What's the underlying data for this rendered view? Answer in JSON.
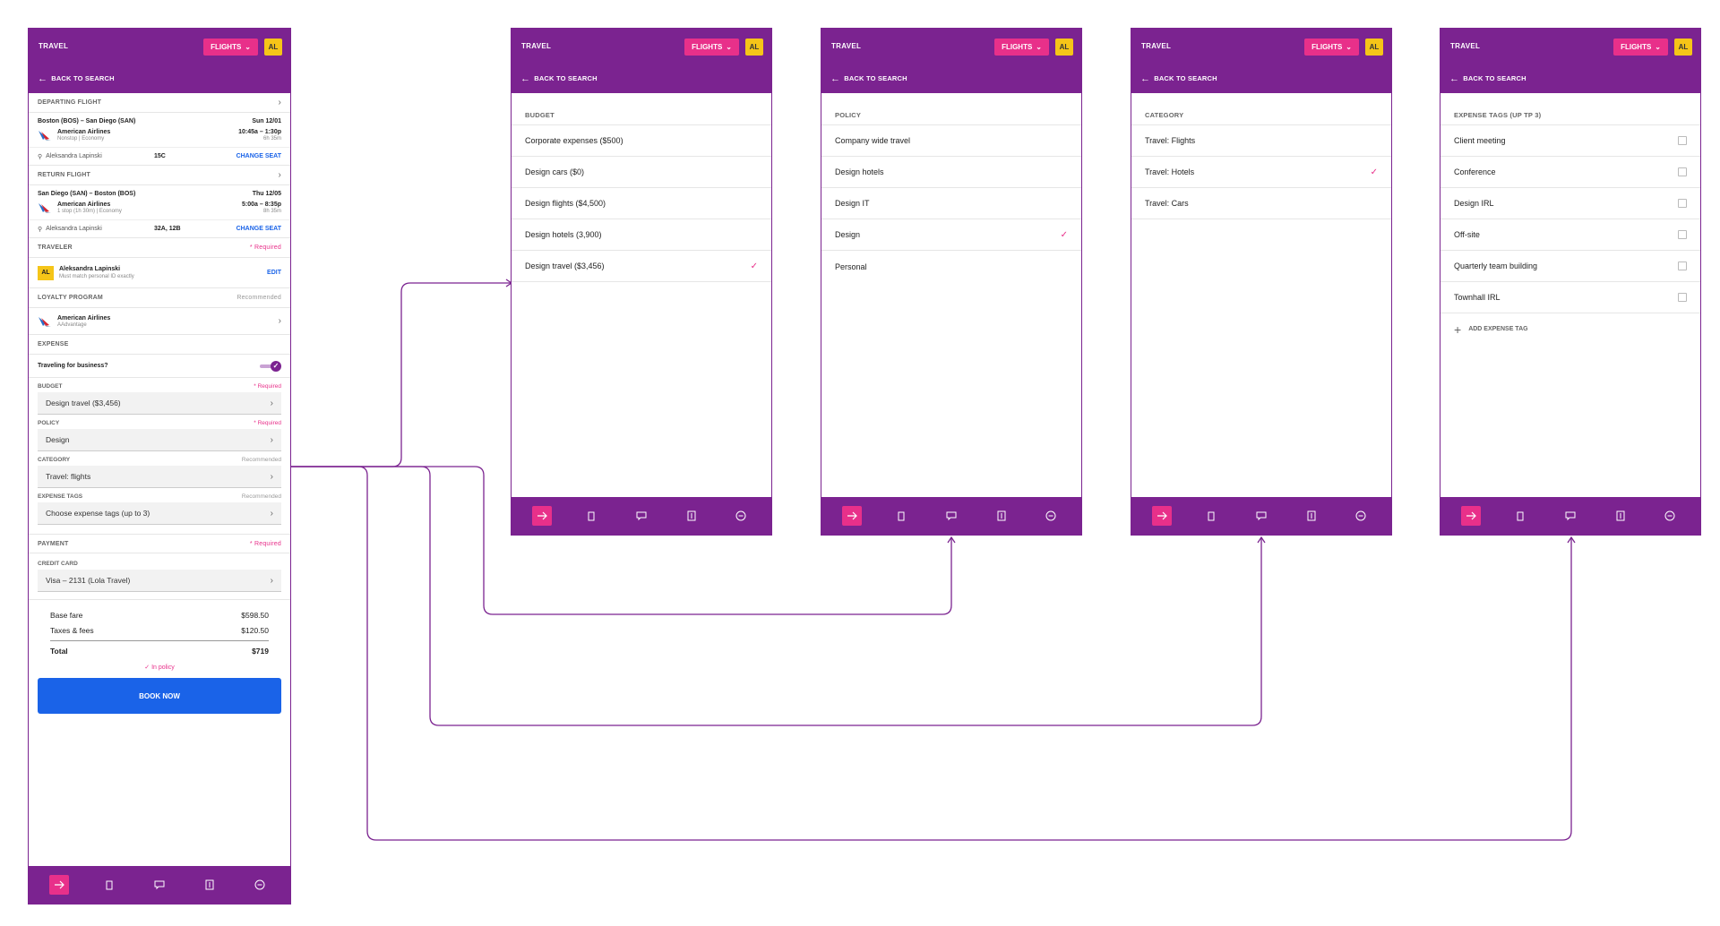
{
  "app": {
    "title": "TRAVEL",
    "flights_label": "FLIGHTS",
    "avatar_initials": "AL",
    "back_label": "BACK TO SEARCH"
  },
  "nav_icons": [
    "flight-icon",
    "luggage-icon",
    "chat-icon",
    "receipt-icon",
    "more-icon"
  ],
  "colors": {
    "header": "#7b2390",
    "accent": "#e8308a",
    "primary_button": "#1a63e8",
    "avatar": "#f5c518"
  },
  "booking": {
    "departing": {
      "header": "DEPARTING FLIGHT",
      "route": "Boston (BOS) – San Diego (SAN)",
      "date": "Sun 12/01",
      "airline": "American Airlines",
      "detail": "Nonstop | Economy",
      "times": "10:45a – 1:30p",
      "duration": "6h 35m",
      "traveler": "Aleksandra Lapinski",
      "seat": "15C",
      "change_seat": "CHANGE SEAT"
    },
    "return": {
      "header": "RETURN FLIGHT",
      "route": "San Diego (SAN) – Boston (BOS)",
      "date": "Thu 12/05",
      "airline": "American Airlines",
      "detail": "1 stop (1h 30m) | Economy",
      "times": "5:00a – 8:35p",
      "duration": "8h 35m",
      "traveler": "Aleksandra Lapinski",
      "seat": "32A, 12B",
      "change_seat": "CHANGE SEAT"
    },
    "traveler_section": {
      "header": "TRAVELER",
      "required": "* Required",
      "name": "Aleksandra Lapinski",
      "note": "Must match personal ID exactly",
      "edit": "EDIT"
    },
    "loyalty": {
      "header": "LOYALTY PROGRAM",
      "recommended": "Recommended",
      "airline": "American Airlines",
      "program": "AAdvantage"
    },
    "expense": {
      "header": "EXPENSE",
      "business_question": "Traveling for business?",
      "business_on": true,
      "budget_label": "BUDGET",
      "budget_req": "* Required",
      "budget_value": "Design travel  ($3,456)",
      "policy_label": "POLICY",
      "policy_req": "* Required",
      "policy_value": "Design",
      "category_label": "CATEGORY",
      "category_rec": "Recommended",
      "category_value": "Travel: flights",
      "tags_label": "EXPENSE TAGS",
      "tags_rec": "Recommended",
      "tags_value": "Choose expense tags (up to 3)"
    },
    "payment": {
      "header": "PAYMENT",
      "required": "* Required",
      "card_label": "CREDIT CARD",
      "card_value": "Visa – 2131 (Lola Travel)"
    },
    "fare": {
      "base_label": "Base fare",
      "base_value": "$598.50",
      "taxes_label": "Taxes & fees",
      "taxes_value": "$120.50",
      "total_label": "Total",
      "total_value": "$719",
      "policy_status": "In policy"
    },
    "book_label": "BOOK NOW"
  },
  "budget_screen": {
    "header": "BUDGET",
    "items": [
      {
        "label": "Corporate expenses ($500)",
        "selected": false
      },
      {
        "label": "Design cars ($0)",
        "selected": false
      },
      {
        "label": "Design flights ($4,500)",
        "selected": false
      },
      {
        "label": "Design hotels (3,900)",
        "selected": false
      },
      {
        "label": "Design travel ($3,456)",
        "selected": true
      }
    ]
  },
  "policy_screen": {
    "header": "POLICY",
    "items": [
      {
        "label": "Company wide travel",
        "selected": false
      },
      {
        "label": "Design hotels",
        "selected": false
      },
      {
        "label": "Design IT",
        "selected": false
      },
      {
        "label": "Design",
        "selected": true
      },
      {
        "label": "Personal",
        "selected": false
      }
    ]
  },
  "category_screen": {
    "header": "CATEGORY",
    "items": [
      {
        "label": "Travel: Flights",
        "selected": false
      },
      {
        "label": "Travel: Hotels",
        "selected": true
      },
      {
        "label": "Travel: Cars",
        "selected": false
      }
    ]
  },
  "tags_screen": {
    "header": "EXPENSE TAGS (UP TP 3)",
    "items": [
      {
        "label": "Client meeting",
        "checked": false
      },
      {
        "label": "Conference",
        "checked": false
      },
      {
        "label": "Design IRL",
        "checked": false
      },
      {
        "label": "Off-site",
        "checked": false
      },
      {
        "label": "Quarterly team building",
        "checked": false
      },
      {
        "label": "Townhall IRL",
        "checked": false
      }
    ],
    "add_label": "ADD EXPENSE TAG"
  }
}
